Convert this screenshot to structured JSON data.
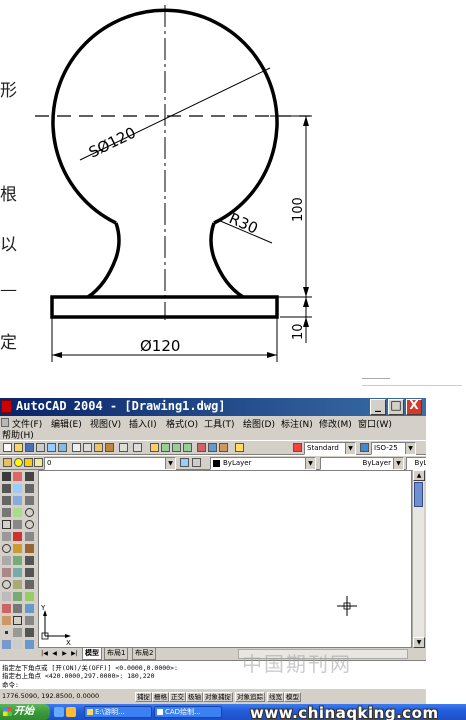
{
  "figure": {
    "side_chars": [
      "形",
      "根",
      "以",
      "—",
      "定"
    ],
    "dim_sphere": "SØ120",
    "dim_radius": "R30",
    "dim_height_body": "100",
    "dim_height_base": "10",
    "dim_base_width": "Ø120"
  },
  "window": {
    "title": "AutoCAD 2004 - [Drawing1.dwg]",
    "controls": {
      "minimize": "_",
      "maximize": "□",
      "close": "X"
    }
  },
  "menu": {
    "items": [
      "文件(F)",
      "编辑(E)",
      "视图(V)",
      "插入(I)",
      "格式(O)",
      "工具(T)",
      "绘图(D)",
      "标注(N)",
      "修改(M)",
      "窗口(W)"
    ],
    "help": "帮助(H)"
  },
  "toolbar": {
    "text_style": "Standard",
    "dim_style": "ISO-25",
    "layer": "0",
    "color": "ByLayer",
    "linetype": "ByLayer",
    "lineweight": "ByLayer"
  },
  "tabs": [
    "模型",
    "布局1",
    "布局2"
  ],
  "command": {
    "lines": [
      "指定左下角点或 [开(ON)/关(OFF)] <0.0000,0.0000>:",
      "指定右上角点 <420.0000,297.0000>: 180,220",
      "命令:"
    ]
  },
  "status": {
    "coords": "1776.5090, 192.8500, 0.0000",
    "buttons": [
      "捕捉",
      "栅格",
      "正交",
      "极轴",
      "对象捕捉",
      "对象追踪",
      "线宽",
      "模型"
    ]
  },
  "taskbar": {
    "start": "开始",
    "tasks": [
      "E:\\游明...",
      "CAD绘制..."
    ],
    "url": "www.chinaqking.com"
  },
  "watermark": "中国期刊网"
}
